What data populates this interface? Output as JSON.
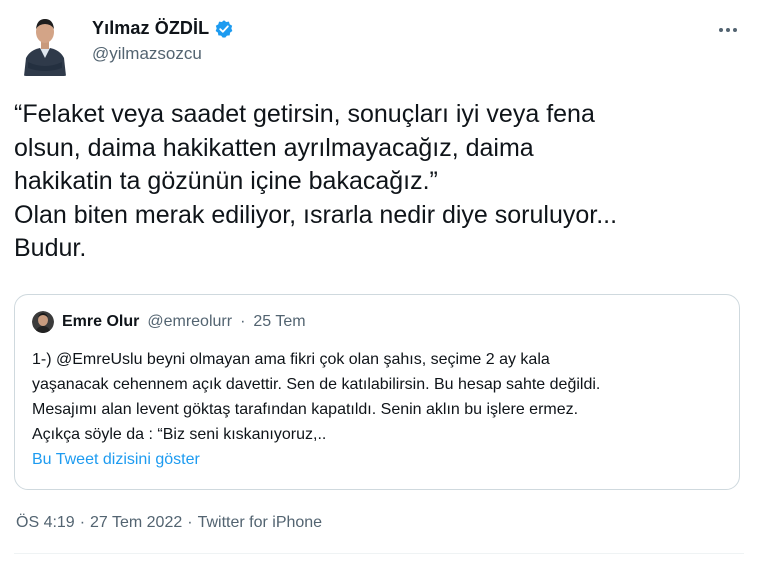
{
  "author": {
    "display_name": "Yılmaz ÖZDİL",
    "handle": "@yilmazsozcu",
    "verified": true
  },
  "more_icon": "more-horizontal-icon",
  "tweet": {
    "text": "“Felaket veya saadet getirsin, sonuçları iyi veya fena\nolsun, daima hakikatten ayrılmayacağız, daima\nhakikatin ta gözünün içine bakacağız.”\nOlan biten merak ediliyor, ısrarla nedir diye soruluyor...\nBudur."
  },
  "quoted_tweet": {
    "display_name": "Emre Olur",
    "handle": "@emreolurr",
    "separator": "·",
    "date": "25 Tem",
    "text": "1-) @EmreUslu beyni olmayan ama fikri çok olan şahıs, seçime 2 ay kala\nyaşanacak cehennem açık davettir. Sen de katılabilirsin. Bu hesap sahte değildi.\nMesajımı alan levent göktaş tarafından kapatıldı. Senin aklın bu işlere ermez.\nAçıkça söyle da : “Biz seni kıskanıyoruz,..",
    "thread_link": "Bu Tweet dizisini göster"
  },
  "meta": {
    "time": "ÖS 4:19",
    "sep1": "·",
    "date": "27 Tem 2022",
    "sep2": "·",
    "source": "Twitter for iPhone"
  },
  "colors": {
    "text": "#0f1419",
    "secondary": "#536471",
    "accent": "#1d9bf0",
    "border": "#cfd9de"
  }
}
